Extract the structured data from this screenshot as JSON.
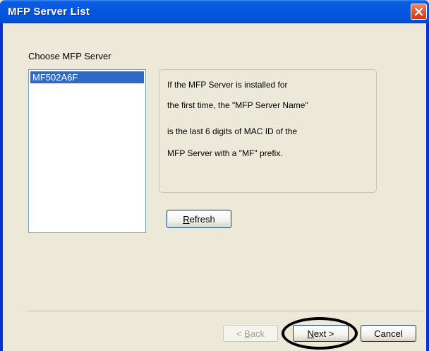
{
  "window": {
    "title": "MFP Server List"
  },
  "server_list": {
    "label": "Choose MFP Server",
    "items": [
      "MF502A6F"
    ],
    "selected_index": 0
  },
  "info": {
    "lines": [
      "If the MFP Server is installed for",
      "the first time, the \"MFP Server Name\"",
      "is the last 6 digits of MAC ID of the",
      "MFP Server with a \"MF\" prefix."
    ]
  },
  "buttons": {
    "refresh": {
      "mnemonic": "R",
      "rest": "efresh"
    },
    "back": {
      "prefix": "< ",
      "mnemonic": "B",
      "rest": "ack"
    },
    "next": {
      "mnemonic": "N",
      "rest": "ext >"
    },
    "cancel": "Cancel"
  },
  "colors": {
    "title_bar": "#0558e0",
    "selection": "#316ac5",
    "close_button": "#e0542e"
  }
}
